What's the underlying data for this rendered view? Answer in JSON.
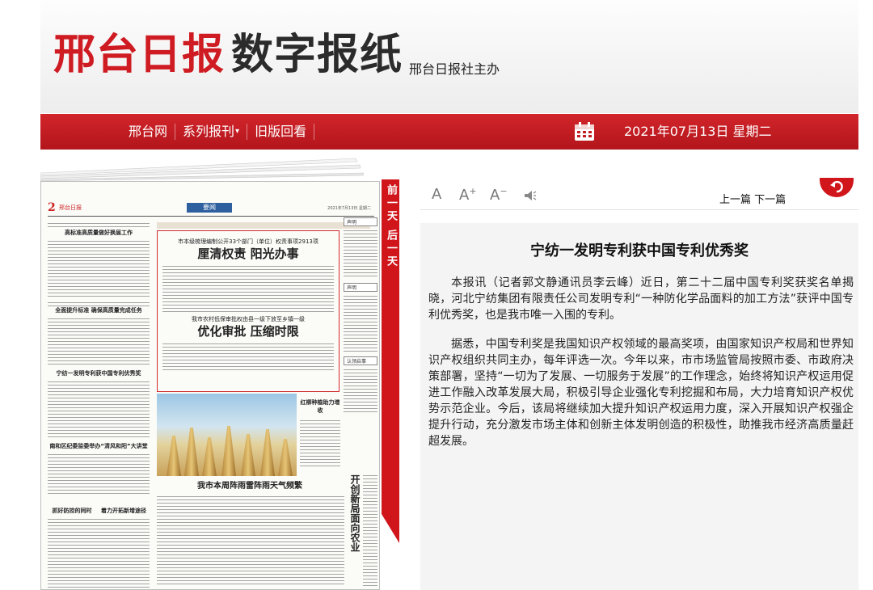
{
  "masthead": {
    "logo_red": "邢台日报",
    "logo_dark": "数字报纸",
    "subtitle": "邢台日报社主办"
  },
  "nav": {
    "items": [
      "邢台网",
      "系列报刊",
      "旧版回看"
    ],
    "date": "2021年07月13日 星期二"
  },
  "newspaper": {
    "page_number": "2",
    "masthead": "邢台日报",
    "section": "要闻",
    "date": "2021年7月13日 星期二",
    "headlines": {
      "left1": "高标准高质量做好换届工作",
      "left2": "全面提升标准 确保高质量完成任务",
      "left3": "宁纺一发明专利获中国专利优秀奖",
      "left4": "南和区纪委监委举办“清风和阳”大讲堂",
      "left5": "抓好防控的同时",
      "left6": "着力开拓新增途径",
      "box_kicker": "市本级梳理编制公开33个部门（单位）权责事项2913项",
      "box_main": "厘清权责 阳光办事",
      "box_kicker2": "我市农村低保审批权由县一级下放至乡镇一级",
      "box_main2": "优化审批 压缩时限",
      "photo_caption": "我市本周阵雨雷阵雨天气频繁",
      "notice1": "声明",
      "notice2": "认领启事",
      "vertical": "开创新局面向农业",
      "photo_tag": "红柳种植助力增收"
    }
  },
  "side_tab": {
    "prev": "前一天",
    "next": "后一天"
  },
  "toolbar": {
    "font_normal": "A",
    "font_up": "A",
    "font_down": "A",
    "prev_article": "上一篇",
    "next_article": "下一篇"
  },
  "article": {
    "title": "宁纺一发明专利获中国专利优秀奖",
    "paragraphs": [
      "本报讯（记者郭文静通讯员李云峰）近日，第二十二届中国专利奖获奖名单揭晓，河北宁纺集团有限责任公司发明专利“一种防化学品面料的加工方法”获评中国专利优秀奖，也是我市唯一入围的专利。",
      "据悉，中国专利奖是我国知识产权领域的最高奖项，由国家知识产权局和世界知识产权组织共同主办，每年评选一次。今年以来，市市场监管局按照市委、市政府决策部署，坚持“一切为了发展、一切服务于发展”的工作理念，始终将知识产权运用促进工作融入改革发展大局，积极引导企业强化专利挖掘和布局，大力培育知识产权优势示范企业。今后，该局将继续加大提升知识产权运用力度，深入开展知识产权强企提升行动，充分激发市场主体和创新主体发明创造的积极性，助推我市经济高质量赶超发展。"
    ]
  },
  "colors": {
    "brand_red": "#cf1b22",
    "nav_red": "#c21b21",
    "article_bg": "#f4f4f4"
  },
  "icons": [
    "calendar-icon",
    "speaker-icon",
    "back-arrow-icon",
    "caret-down-icon"
  ]
}
